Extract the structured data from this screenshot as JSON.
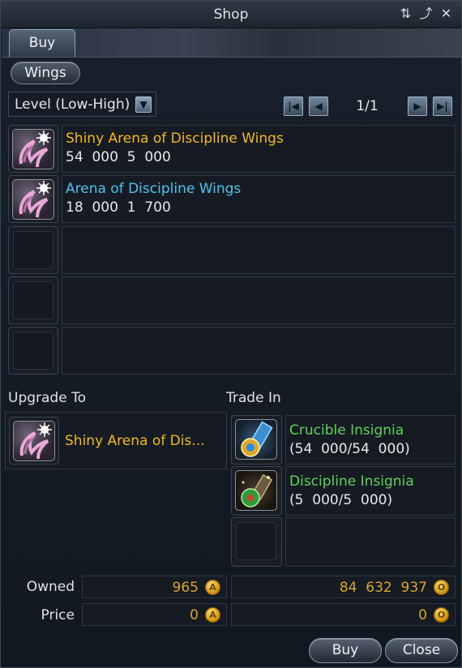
{
  "window": {
    "title": "Shop",
    "title_icons": [
      "refresh-icon",
      "undock-icon",
      "close-icon"
    ]
  },
  "tabs": {
    "buy_label": "Buy"
  },
  "category": {
    "label": "Wings"
  },
  "sort": {
    "label": "Level (Low-High)"
  },
  "pager": {
    "text": "1/1"
  },
  "items": [
    {
      "name": "Shiny Arena of Discipline Wings",
      "cost": "54  000  5  000",
      "name_color": "#f3b81f",
      "icon": "wings-icon"
    },
    {
      "name": "Arena of Discipline Wings",
      "cost": "18  000  1  700",
      "name_color": "#4fc3f0",
      "icon": "wings-icon"
    }
  ],
  "upgrade": {
    "label": "Upgrade To",
    "item_name": "Shiny Arena of Dis...",
    "icon": "wings-icon"
  },
  "trade_in": {
    "label": "Trade In",
    "items": [
      {
        "name": "Crucible Insignia",
        "count": "(54  000/54  000)",
        "icon": "crucible-insignia-icon"
      },
      {
        "name": "Discipline Insignia",
        "count": "(5  000/5  000)",
        "icon": "discipline-insignia-icon"
      }
    ]
  },
  "stats": {
    "owned_label": "Owned",
    "owned_left": "965",
    "owned_right": "84  632  937",
    "price_label": "Price",
    "price_left": "0",
    "price_right": "0",
    "coin_left_letter": "A",
    "coin_right_letter": "O"
  },
  "buttons": {
    "buy": "Buy",
    "close": "Close"
  },
  "colors": {
    "rare_name": "#f3b81f",
    "common_name": "#4fc3f0",
    "trade_name": "#5fd15c"
  }
}
